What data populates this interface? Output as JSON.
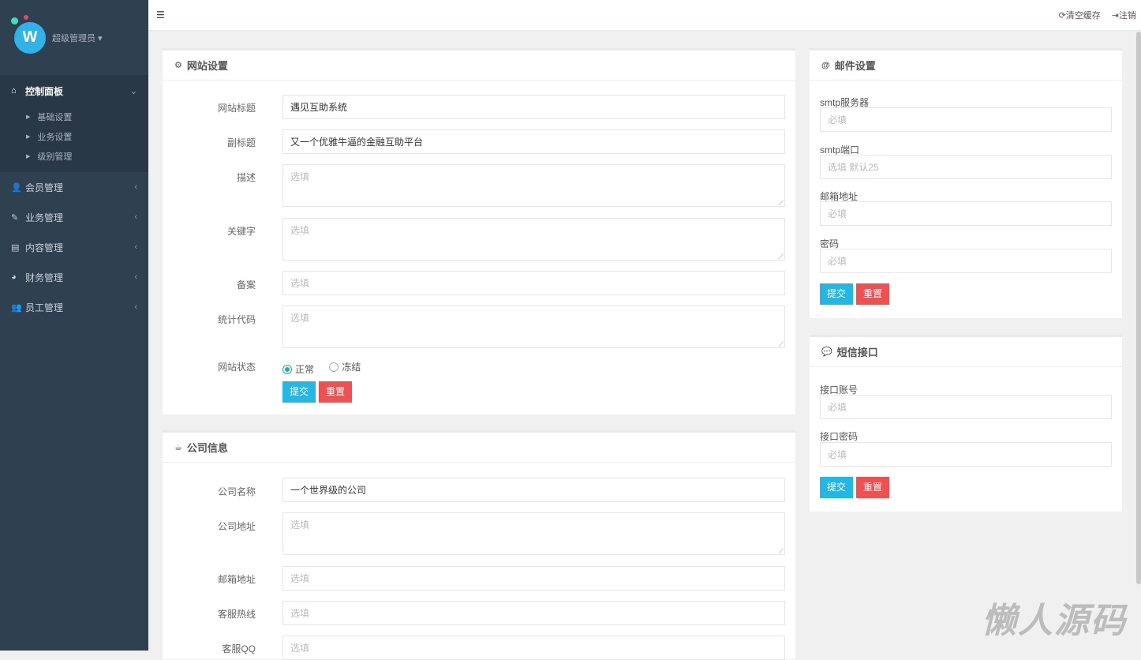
{
  "sidebar": {
    "user": "超级管理员 ▾",
    "active": "控制面板",
    "subitems": [
      "基础设置",
      "业务设置",
      "级别管理"
    ],
    "items": [
      "会员管理",
      "业务管理",
      "内容管理",
      "财务管理",
      "员工管理"
    ]
  },
  "topbar": {
    "clear_cache": "清空缓存",
    "logout": "注销"
  },
  "site": {
    "title": "网站设置",
    "fields": [
      {
        "label": "网站标题",
        "value": "遇见互助系统"
      },
      {
        "label": "副标题",
        "value": "又一个优雅牛逼的金融互助平台"
      },
      {
        "label": "描述",
        "placeholder": "选填"
      },
      {
        "label": "关键字",
        "placeholder": "选填"
      },
      {
        "label": "备案",
        "placeholder": "选填"
      },
      {
        "label": "统计代码",
        "placeholder": "选填"
      }
    ],
    "status_label": "网站状态",
    "status_options": [
      "正常",
      "冻结"
    ],
    "submit": "提交",
    "reset": "重置"
  },
  "company": {
    "title": "公司信息",
    "fields": [
      {
        "label": "公司名称",
        "value": "一个世界级的公司"
      },
      {
        "label": "公司地址",
        "placeholder": "选填"
      },
      {
        "label": "邮箱地址",
        "placeholder": "选填"
      },
      {
        "label": "客服热线",
        "placeholder": "选填"
      },
      {
        "label": "客服QQ",
        "placeholder": "选填"
      }
    ]
  },
  "mail": {
    "title": "邮件设置",
    "fields": [
      {
        "label": "smtp服务器",
        "placeholder": "必填"
      },
      {
        "label": "smtp端口",
        "placeholder": "选填 默认25"
      },
      {
        "label": "邮箱地址",
        "placeholder": "必填"
      },
      {
        "label": "密码",
        "placeholder": "必填"
      }
    ],
    "submit": "提交",
    "reset": "重置"
  },
  "sms": {
    "title": "短信接口",
    "fields": [
      {
        "label": "接口账号",
        "placeholder": "必填"
      },
      {
        "label": "接口密码",
        "placeholder": "必填"
      }
    ],
    "submit": "提交",
    "reset": "重置"
  },
  "watermark": "懒人源码"
}
